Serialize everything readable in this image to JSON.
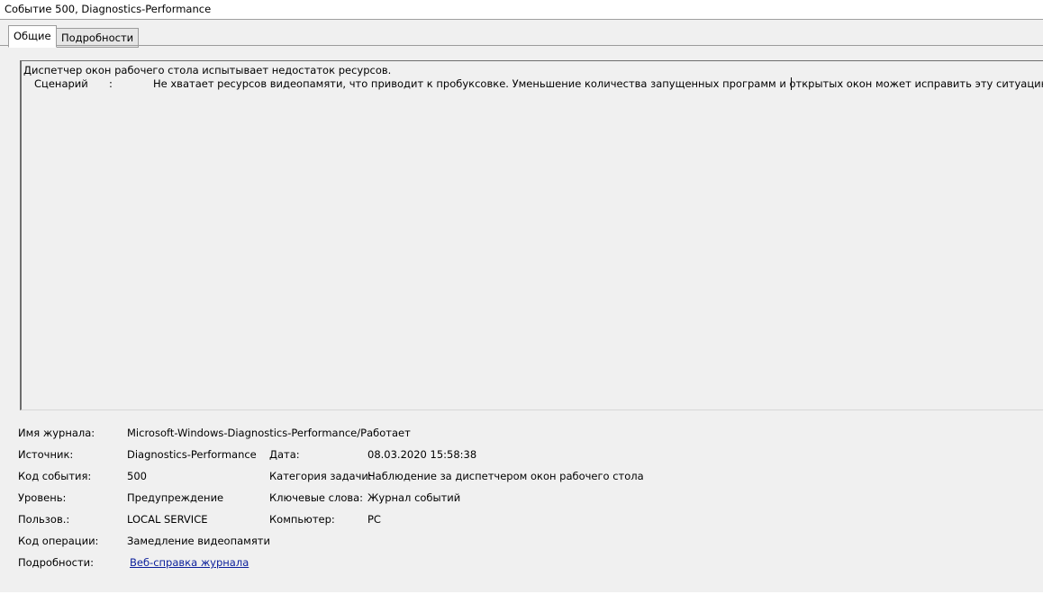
{
  "window": {
    "title": "Событие 500, Diagnostics-Performance"
  },
  "tabs": [
    {
      "label": "Общие",
      "active": true
    },
    {
      "label": "Подробности",
      "active": false
    }
  ],
  "description": {
    "line1": "Диспетчер окон рабочего стола испытывает недостаток ресурсов.",
    "scenario_label": "Сценарий",
    "scenario_colon": ":",
    "scenario_text": "Не хватает ресурсов видеопамяти, что приводит к пробуксовке. Уменьшение количества запущенных программ и открытых окон может исправить эту ситуацию."
  },
  "properties": {
    "log_name_label": "Имя журнала:",
    "log_name_value": "Microsoft-Windows-Diagnostics-Performance/Работает",
    "source_label": "Источник:",
    "source_value": "Diagnostics-Performance",
    "date_label": "Дата:",
    "date_value": "08.03.2020 15:58:38",
    "event_id_label": "Код события:",
    "event_id_value": "500",
    "task_category_label": "Категория задачи:",
    "task_category_value": "Наблюдение за диспетчером окон рабочего стола",
    "level_label": "Уровень:",
    "level_value": "Предупреждение",
    "keywords_label": "Ключевые слова:",
    "keywords_value": "Журнал событий",
    "user_label": "Пользов.:",
    "user_value": "LOCAL SERVICE",
    "computer_label": "Компьютер:",
    "computer_value": "PC",
    "opcode_label": "Код операции:",
    "opcode_value": "Замедление видеопамяти",
    "details_label": "Подробности:",
    "details_link": "Веб-справка журнала"
  }
}
